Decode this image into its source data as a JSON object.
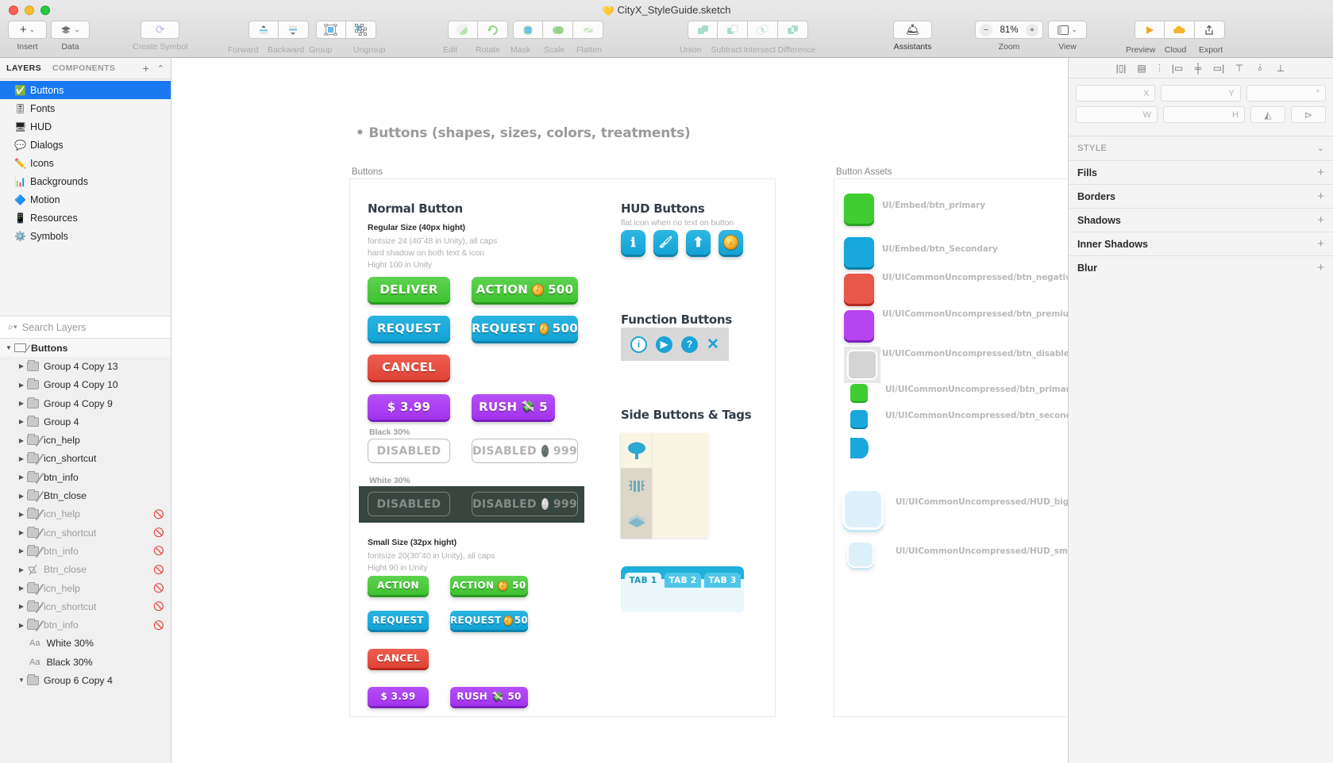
{
  "window": {
    "title": "CityX_StyleGuide.sketch",
    "sketch_icon": "sketch-diamond-icon"
  },
  "toolbar": {
    "groups": [
      {
        "label": "Insert",
        "dim": false
      },
      {
        "label": "Data",
        "dim": false
      },
      {
        "label": "Create Symbol",
        "dim": true
      },
      {
        "label": "Forward",
        "dim": true
      },
      {
        "label": "Backward",
        "dim": true
      },
      {
        "label": "Group",
        "dim": true
      },
      {
        "label": "Ungroup",
        "dim": true
      },
      {
        "label": "Edit",
        "dim": true
      },
      {
        "label": "Rotate",
        "dim": true
      },
      {
        "label": "Mask",
        "dim": true
      },
      {
        "label": "Scale",
        "dim": true
      },
      {
        "label": "Flatten",
        "dim": true
      },
      {
        "label": "Union",
        "dim": true
      },
      {
        "label": "Subtract",
        "dim": true
      },
      {
        "label": "Intersect",
        "dim": true
      },
      {
        "label": "Difference",
        "dim": true
      },
      {
        "label": "Assistants",
        "dim": false
      },
      {
        "label": "Zoom",
        "dim": false
      },
      {
        "label": "View",
        "dim": false
      },
      {
        "label": "Preview",
        "dim": false
      },
      {
        "label": "Cloud",
        "dim": false
      },
      {
        "label": "Export",
        "dim": false
      }
    ],
    "zoom_value": "81%",
    "zoom_minus": "−",
    "zoom_plus": "+"
  },
  "sidebar": {
    "tabs": [
      {
        "label": "LAYERS",
        "active": true
      },
      {
        "label": "COMPONENTS",
        "active": false
      }
    ],
    "add_label": "+",
    "collapse_label": "⌃",
    "pages": [
      {
        "emoji": "✅",
        "label": "Buttons",
        "selected": true
      },
      {
        "emoji": "🎚",
        "label": "Fonts",
        "selected": false
      },
      {
        "emoji": "🖥",
        "label": "HUD",
        "selected": false
      },
      {
        "emoji": "💬",
        "label": "Dialogs",
        "selected": false
      },
      {
        "emoji": "✏️",
        "label": "Icons",
        "selected": false
      },
      {
        "emoji": "📊",
        "label": "Backgrounds",
        "selected": false
      },
      {
        "emoji": "🔷",
        "label": "Motion",
        "selected": false
      },
      {
        "emoji": "📱",
        "label": "Resources",
        "selected": false
      },
      {
        "emoji": "⚙️",
        "label": "Symbols",
        "selected": false
      }
    ],
    "search": {
      "placeholder": "Search Layers",
      "value": "",
      "icon": "search-icon"
    },
    "layer_root": {
      "label": "Buttons",
      "icon": "artboard-icon",
      "expanded": true
    },
    "layers": [
      {
        "label": "Group 4 Copy 13",
        "icon": "folder-icon",
        "hidden": false
      },
      {
        "label": "Group 4 Copy 10",
        "icon": "folder-icon",
        "hidden": false
      },
      {
        "label": "Group 4 Copy 9",
        "icon": "folder-icon",
        "hidden": false
      },
      {
        "label": "Group 4",
        "icon": "folder-icon",
        "hidden": false
      },
      {
        "label": "icn_help",
        "icon": "folder-slash-icon",
        "hidden": false
      },
      {
        "label": "icn_shortcut",
        "icon": "folder-slash-icon",
        "hidden": false
      },
      {
        "label": "btn_info",
        "icon": "folder-slash-icon",
        "hidden": false
      },
      {
        "label": "Btn_close",
        "icon": "folder-slash-icon",
        "hidden": false
      },
      {
        "label": "icn_help",
        "icon": "folder-slash-icon",
        "hidden": true
      },
      {
        "label": "icn_shortcut",
        "icon": "folder-slash-icon",
        "hidden": true
      },
      {
        "label": "btn_info",
        "icon": "folder-slash-icon",
        "hidden": true
      },
      {
        "label": "Btn_close",
        "icon": "shape-slash-icon",
        "hidden": true
      },
      {
        "label": "icn_help",
        "icon": "folder-slash-icon",
        "hidden": true
      },
      {
        "label": "icn_shortcut",
        "icon": "folder-slash-icon",
        "hidden": true
      },
      {
        "label": "btn_info",
        "icon": "folder-slash-icon",
        "hidden": true
      }
    ],
    "text_layers": [
      {
        "prefix": "Aa",
        "label": "White 30%"
      },
      {
        "prefix": "Aa",
        "label": "Black 30%"
      }
    ],
    "layer_group_bottom": {
      "label": "Group 6 Copy 4",
      "icon": "folder-icon"
    }
  },
  "canvas": {
    "page_title": "• Buttons (shapes, sizes, colors, treatments)",
    "artboards": [
      {
        "name": "Buttons"
      },
      {
        "name": "Button Assets"
      }
    ],
    "sections": {
      "normal_button": {
        "heading": "Normal Button",
        "regular": {
          "sub": "Regular Size (40px hight)",
          "notes": [
            "fontsize 24 (40˜48 in Unity), all caps",
            "hard shadow on both text & icon",
            "Hight 100 in Unity"
          ]
        },
        "small": {
          "sub": "Small Size (32px hight)",
          "notes": [
            "fontsize 20(30˜40 in Unity), all caps",
            "Hight 90 in Unity"
          ]
        },
        "label_black30": "Black 30%",
        "label_white30": "White 30%",
        "buttons_regular": [
          {
            "text": "DELIVER",
            "color": "green",
            "icon": null,
            "amount": null
          },
          {
            "text": "ACTION",
            "color": "green",
            "icon": "coin",
            "amount": "500"
          },
          {
            "text": "REQUEST",
            "color": "blue",
            "icon": null,
            "amount": null
          },
          {
            "text": "REQUEST",
            "color": "blue",
            "icon": "coin",
            "amount": "500"
          },
          {
            "text": "CANCEL",
            "color": "red",
            "icon": null,
            "amount": null
          },
          {
            "text": "$ 3.99",
            "color": "purple",
            "icon": null,
            "amount": null
          },
          {
            "text": "RUSH",
            "color": "purple",
            "icon": "cash",
            "amount": "5"
          }
        ],
        "buttons_disabled_black": [
          {
            "text": "DISABLED",
            "icon": null,
            "amount": null
          },
          {
            "text": "DISABLED",
            "icon": "coin",
            "amount": "999"
          }
        ],
        "buttons_disabled_white": [
          {
            "text": "DISABLED",
            "icon": null,
            "amount": null
          },
          {
            "text": "DISABLED",
            "icon": "coin",
            "amount": "999"
          }
        ],
        "buttons_small": [
          {
            "text": "ACTION",
            "color": "green",
            "icon": null,
            "amount": null
          },
          {
            "text": "ACTION",
            "color": "green",
            "icon": "coin",
            "amount": "50"
          },
          {
            "text": "REQUEST",
            "color": "blue",
            "icon": null,
            "amount": null
          },
          {
            "text": "REQUEST",
            "color": "blue",
            "icon": "coin",
            "amount": "50"
          },
          {
            "text": "CANCEL",
            "color": "red",
            "icon": null,
            "amount": null
          },
          {
            "text": "$ 3.99",
            "color": "purple",
            "icon": null,
            "amount": null
          },
          {
            "text": "RUSH",
            "color": "purple",
            "icon": "cash",
            "amount": "50"
          }
        ]
      },
      "hud_buttons": {
        "heading": "HUD Buttons",
        "note": "flat icon when no text on button",
        "items": [
          {
            "icon": "info-icon"
          },
          {
            "icon": "brush-icon"
          },
          {
            "icon": "arrow-up-icon"
          },
          {
            "icon": "coin-icon"
          }
        ]
      },
      "function_buttons": {
        "heading": "Function Buttons",
        "items": [
          {
            "icon": "info-circle-icon"
          },
          {
            "icon": "play-circle-icon"
          },
          {
            "icon": "help-circle-icon"
          },
          {
            "icon": "close-x-icon"
          }
        ]
      },
      "side_buttons": {
        "heading": "Side Buttons & Tags",
        "side_tabs": [
          {
            "icon": "tree-icon"
          },
          {
            "icon": "bridge-icon"
          },
          {
            "icon": "layers-icon"
          }
        ],
        "tabs": [
          {
            "label": "TAB 1",
            "active": true
          },
          {
            "label": "TAB 2",
            "active": false
          },
          {
            "label": "TAB 3",
            "active": false
          }
        ]
      }
    },
    "assets": [
      {
        "label": "UI/Embed/btn_primary",
        "color": "#3fcd32",
        "size": "lg",
        "border": null
      },
      {
        "label": "UI/Embed/btn_Secondary",
        "color": "#19a8db",
        "size": "lg",
        "border": null
      },
      {
        "label": "UI/UICommonUncompressed/btn_negative",
        "color": "#e8584a",
        "size": "lg",
        "border": null
      },
      {
        "label": "UI/UICommonUncompressed/btn_premium",
        "color": "#b644f0",
        "size": "lg",
        "border": null
      },
      {
        "label": "UI/UICommonUncompressed/btn_disabled",
        "color": "#d4d4d4",
        "size": "lg",
        "border": "#ffffff"
      },
      {
        "label": "UI/UICommonUncompressed/btn_primary_tiny",
        "color": "#3fcd32",
        "size": "tiny",
        "border": null
      },
      {
        "label": "UI/UICommonUncompressed/btn_secondary_tiny",
        "color": "#19a8db",
        "size": "tiny",
        "border": null
      },
      {
        "label": "",
        "color": "#19a8db",
        "size": "wedge",
        "border": null
      },
      {
        "label": "UI/UICommonUncompressed/HUD_bigGrayBtn",
        "color": "#ddf1fb",
        "size": "big",
        "border": "#c7e7f6"
      },
      {
        "label": "UI/UICommonUncompressed/HUD_smGrayBtn",
        "color": "#ddf1fb",
        "size": "smgray",
        "border": "#c7e7f6"
      }
    ]
  },
  "inspector": {
    "align_icons": [
      "align-left-icon",
      "align-center-h-icon",
      "align-distribute-icon",
      "align-edge-left-icon",
      "align-middle-icon",
      "align-edge-right-icon",
      "align-top-icon",
      "align-center-v-icon",
      "align-bottom-icon"
    ],
    "geometry": {
      "x": {
        "placeholder": "X",
        "value": ""
      },
      "y": {
        "placeholder": "Y",
        "value": ""
      },
      "rotation": {
        "placeholder": "°",
        "value": ""
      },
      "w": {
        "placeholder": "W",
        "value": ""
      },
      "h": {
        "placeholder": "H",
        "value": ""
      },
      "flip_h": "flip-horizontal-icon",
      "flip_v": "flip-vertical-icon"
    },
    "style_header": "STYLE",
    "style_rows": [
      {
        "label": "Fills",
        "action": "+"
      },
      {
        "label": "Borders",
        "action": "+"
      },
      {
        "label": "Shadows",
        "action": "+"
      },
      {
        "label": "Inner Shadows",
        "action": "+"
      },
      {
        "label": "Blur",
        "action": "+"
      }
    ]
  }
}
